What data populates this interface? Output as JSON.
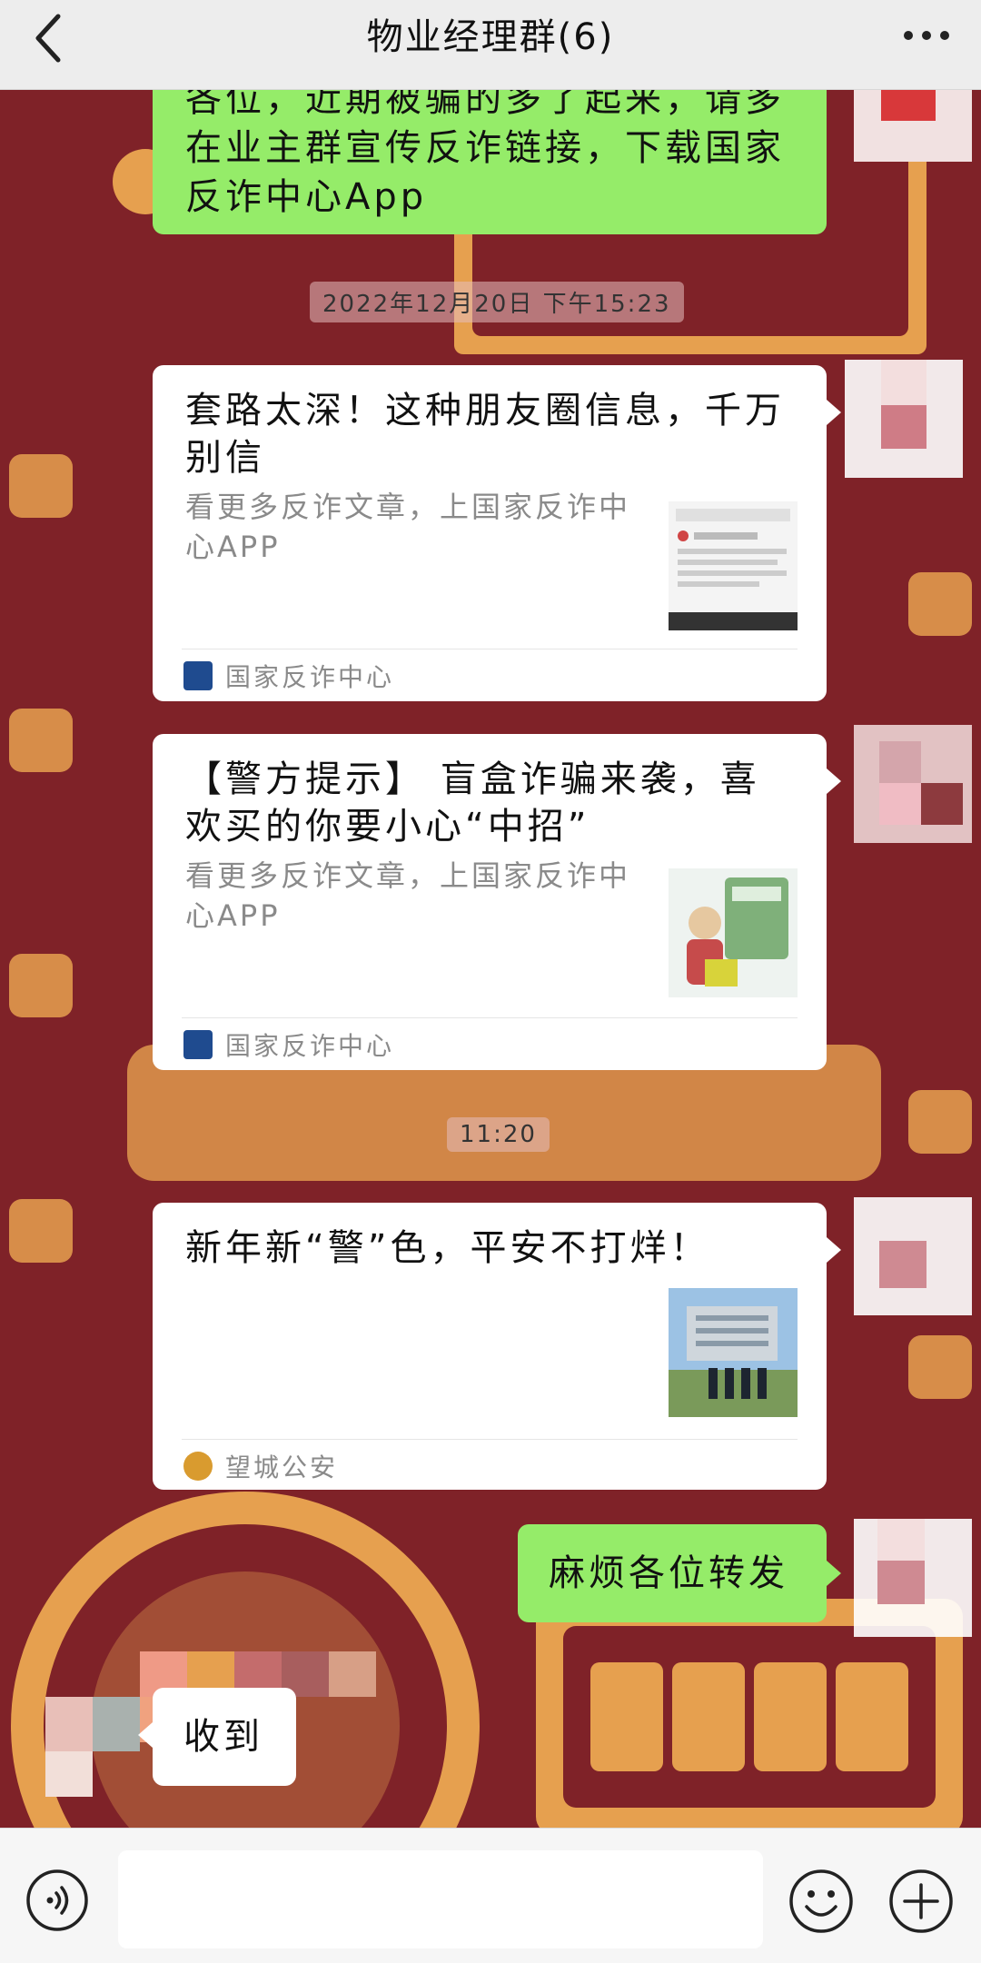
{
  "header": {
    "title": "物业经理群(6)"
  },
  "messages": {
    "m1": {
      "text": "各位，近期被骗的多了起来，请多在业主群宣传反诈链接，下载国家反诈中心App"
    },
    "ts1": "2022年12月20日 下午15:23",
    "card1": {
      "title": "套路太深！这种朋友圈信息，千万别信",
      "desc": "看更多反诈文章，上国家反诈中心APP",
      "source": "国家反诈中心",
      "thumb_icon": "chat-screenshot-thumbnail"
    },
    "card2": {
      "title": "【警方提示】 盲盒诈骗来袭，喜欢买的你要小心“中招”",
      "desc": "看更多反诈文章，上国家反诈中心APP",
      "source": "国家反诈中心",
      "thumb_icon": "blind-box-cartoon-thumbnail"
    },
    "ts2": "11:20",
    "card3": {
      "title": "新年新“警”色，平安不打烊！",
      "source": "望城公安",
      "thumb_icon": "police-building-photo-thumbnail"
    },
    "m2": {
      "text": "麻烦各位转发"
    },
    "m3": {
      "text": "收到"
    }
  },
  "bottom_bar": {
    "input_placeholder": ""
  },
  "colors": {
    "background": "#7f2228",
    "bubble_green": "#95ec69",
    "header_bg": "#ededed"
  }
}
